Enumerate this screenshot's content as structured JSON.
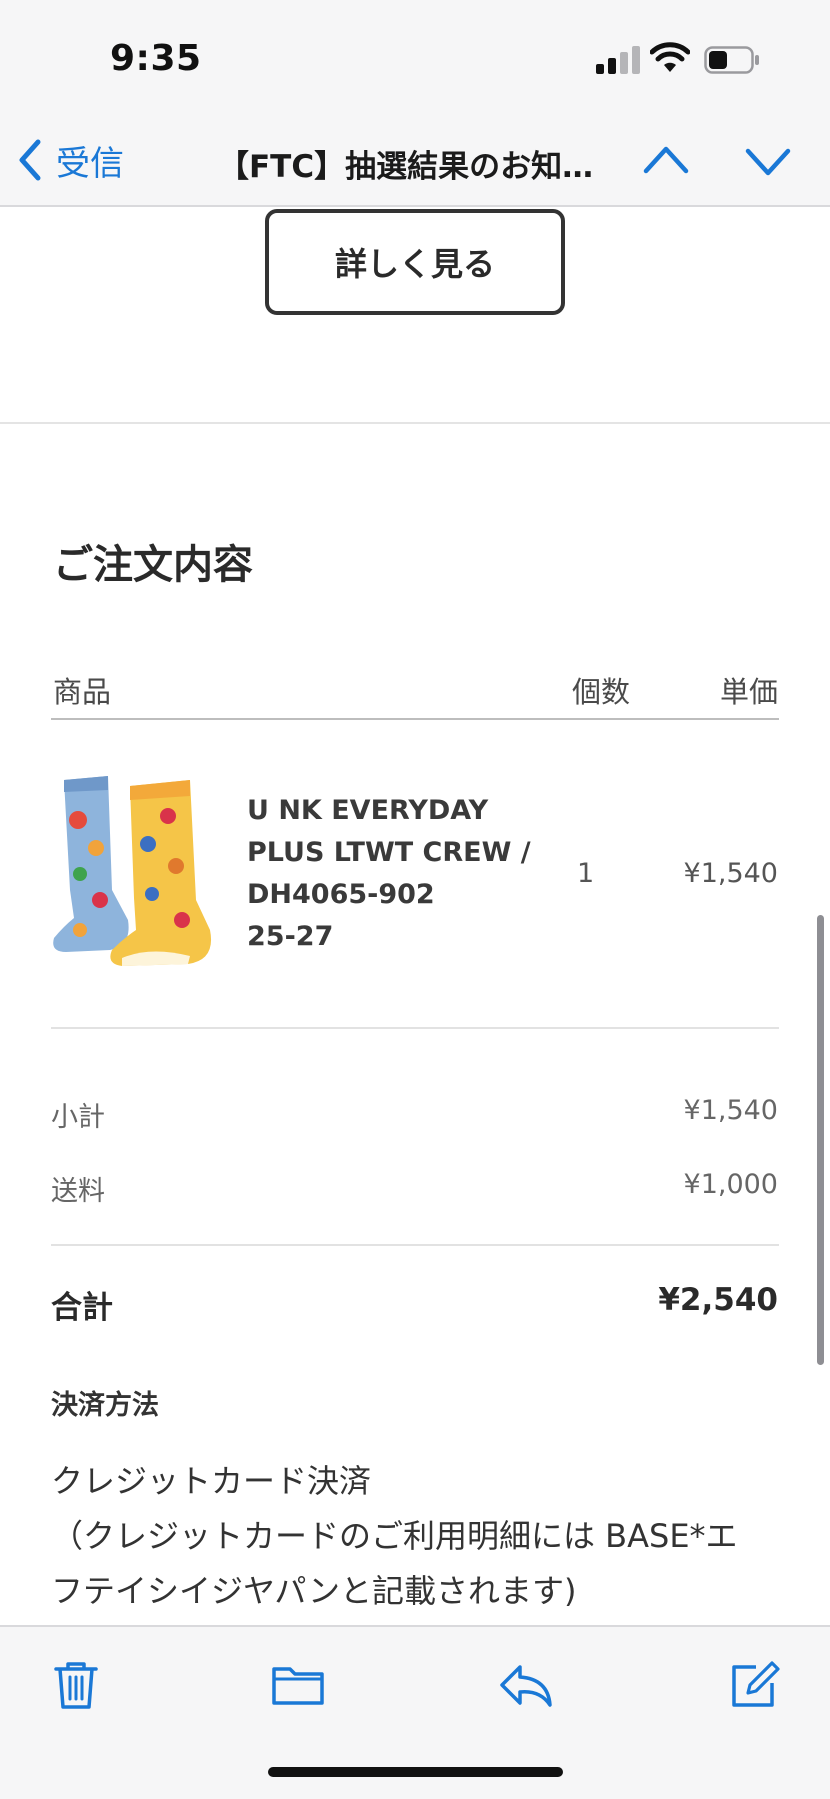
{
  "status_bar": {
    "time": "9:35"
  },
  "nav": {
    "back_label": "受信",
    "title": "【FTC】抽選結果のお知らせ"
  },
  "email": {
    "details_button": "詳しく見る",
    "order_heading": "ご注文内容",
    "table_headers": {
      "product": "商品",
      "quantity": "個数",
      "unit_price": "単価"
    },
    "item": {
      "name_lines": [
        "U NK EVERYDAY",
        "PLUS LTWT CREW /",
        "DH4065-902",
        "25-27"
      ],
      "quantity": "1",
      "unit_price": "¥1,540"
    },
    "summary": {
      "subtotal_label": "小計",
      "subtotal_value": "¥1,540",
      "shipping_label": "送料",
      "shipping_value": "¥1,000",
      "total_label": "合計",
      "total_value": "¥2,540"
    },
    "payment": {
      "heading": "決済方法",
      "lines": [
        "クレジットカード決済",
        "（クレジットカードのご利用明細には BASE*エ",
        "フテイシイジヤパンと記載されます)"
      ]
    }
  },
  "toolbar": {
    "icons": [
      "trash-icon",
      "folder-icon",
      "reply-icon",
      "compose-icon"
    ]
  },
  "colors": {
    "accent": "#1a78d6",
    "bar_background": "#f6f6f7"
  }
}
